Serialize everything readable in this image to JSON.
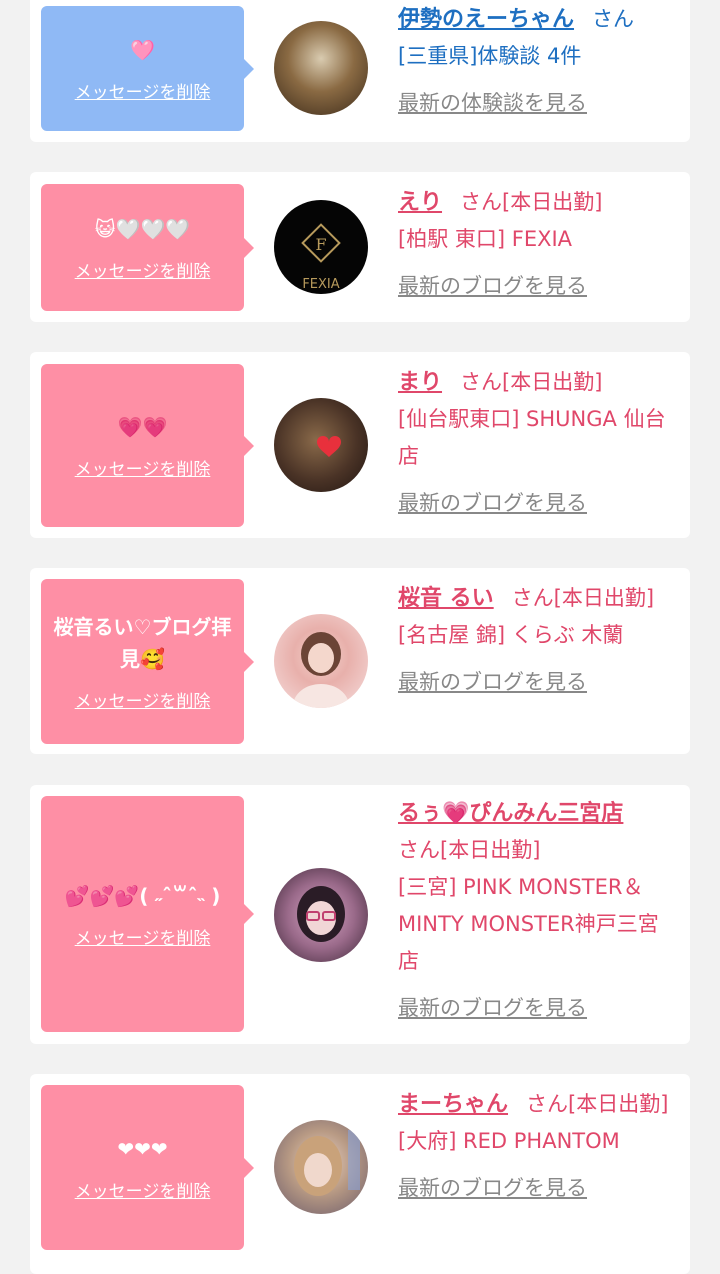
{
  "cards": [
    {
      "message": "🩷",
      "delete_label": "メッセージを削除",
      "name": "伊勢のえーちゃん",
      "suffix": "さん",
      "shop": "[三重県]体験談 4件",
      "link": "最新の体験談を見る"
    },
    {
      "message": "😺🤍🤍🤍",
      "delete_label": "メッセージを削除",
      "name": "えり",
      "suffix": "さん[本日出勤]",
      "shop": "[柏駅 東口] FEXIA",
      "link": "最新のブログを見る"
    },
    {
      "message": "💗💗",
      "delete_label": "メッセージを削除",
      "name": "まり",
      "suffix": "さん[本日出勤]",
      "shop": "[仙台駅東口] SHUNGA 仙台店",
      "link": "最新のブログを見る"
    },
    {
      "message": "桜音るい♡ブログ拝見🥰",
      "delete_label": "メッセージを削除",
      "name": "桜音 るい",
      "suffix": "さん[本日出勤]",
      "shop": "[名古屋 錦] くらぶ 木蘭",
      "link": "最新のブログを見る"
    },
    {
      "message": "💕💕💕( ˶ˆ꒳ˆ˵ )",
      "delete_label": "メッセージを削除",
      "name": "るぅ💗ぴんみん三宮店",
      "suffix": "さん[本日出勤]",
      "shop": "[三宮] PINK MONSTER＆MINTY MONSTER神戸三宮店",
      "link": "最新のブログを見る"
    },
    {
      "message": "❤❤❤",
      "delete_label": "メッセージを削除",
      "name": "まーちゃん",
      "suffix": "さん[本日出勤]",
      "shop": "[大府] RED PHANTOM",
      "link": "最新のブログを見る"
    }
  ],
  "colors": {
    "blue_bubble": "#8fb9f5",
    "pink_bubble": "#fe8fa5",
    "blue_text": "#1e6fc1",
    "pink_text": "#e0476a",
    "link_gray": "#888888"
  }
}
